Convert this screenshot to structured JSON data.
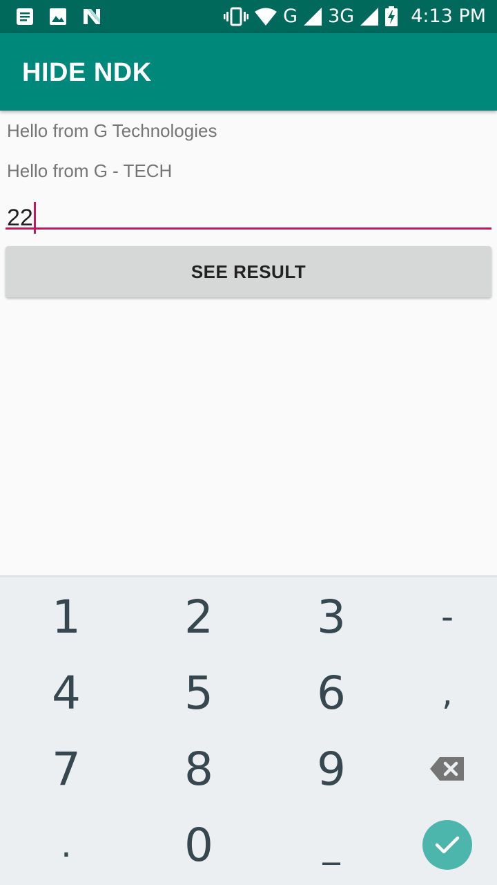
{
  "status_bar": {
    "icons_left": [
      "message-icon",
      "image-icon",
      "n-logo-icon"
    ],
    "icons_right": [
      "vibrate-icon",
      "wifi-icon",
      "signal-icon",
      "battery-icon"
    ],
    "network1": "G",
    "network2": "3G",
    "time": "4:13 PM"
  },
  "app_bar": {
    "title": "HIDE NDK"
  },
  "content": {
    "line1": "Hello from G Technologies",
    "line2": "Hello from G - TECH",
    "input_value": "22",
    "button_label": "SEE RESULT"
  },
  "keyboard": {
    "row1": [
      "1",
      "2",
      "3",
      "-"
    ],
    "row2": [
      "4",
      "5",
      "6",
      ","
    ],
    "row3": [
      "7",
      "8",
      "9"
    ],
    "row4": [
      ".",
      "0",
      "_"
    ],
    "backspace_icon": "backspace-icon",
    "done_icon": "check-icon"
  },
  "colors": {
    "status_bar": "#00695c",
    "app_bar": "#00897b",
    "accent": "#c2185b",
    "done": "#4db6ac"
  }
}
